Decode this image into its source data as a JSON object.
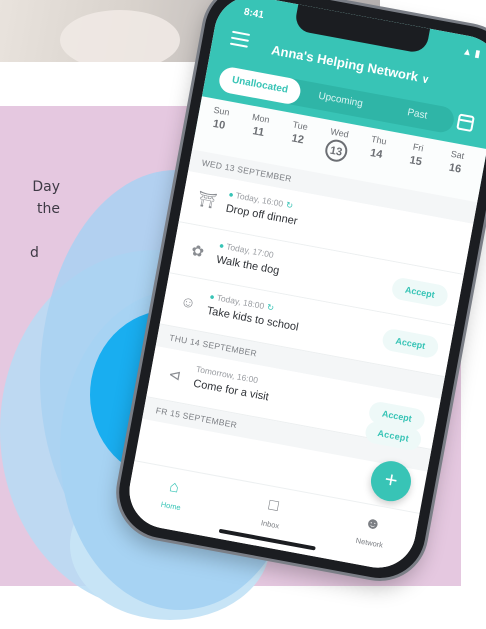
{
  "side_text": [
    "Day",
    "the",
    "d"
  ],
  "phone": {
    "status_time": "8:41",
    "status_icons": "▲ ▮",
    "network_title": "Anna's Helping Network",
    "chevron": "∨",
    "tabs": [
      {
        "label": "Unallocated",
        "active": true
      },
      {
        "label": "Upcoming",
        "active": false
      },
      {
        "label": "Past",
        "active": false
      }
    ],
    "week": [
      {
        "name": "Sun",
        "date": "10"
      },
      {
        "name": "Mon",
        "date": "11"
      },
      {
        "name": "Tue",
        "date": "12"
      },
      {
        "name": "Wed",
        "date": "13",
        "selected": true
      },
      {
        "name": "Thu",
        "date": "14"
      },
      {
        "name": "Fri",
        "date": "15"
      },
      {
        "name": "Sat",
        "date": "16"
      }
    ],
    "sections": [
      {
        "header": "WED 13 SEPTEMBER"
      },
      {
        "header": "THU 14 SEPTEMBER"
      },
      {
        "header": "FR 15 SEPTEMBER"
      }
    ],
    "tasks": [
      {
        "when": "Today, 16:00",
        "title": "Drop off dinner",
        "icon": "dish-icon",
        "repeat": true,
        "accept": ""
      },
      {
        "when": "Today, 17:00",
        "title": "Walk the dog",
        "icon": "paw-icon",
        "repeat": false,
        "accept": "Accept"
      },
      {
        "when": "Today, 18:00",
        "title": "Take kids to school",
        "icon": "baby-icon",
        "repeat": true,
        "accept": "Accept"
      },
      {
        "when": "Tomorrow, 16:00",
        "title": "Come for a visit",
        "icon": "share-icon",
        "repeat": false,
        "accept": "Accept"
      }
    ],
    "accept_label_last": "Accept",
    "fab_label": "+",
    "nav": [
      {
        "label": "Home",
        "icon": "home-icon",
        "active": true
      },
      {
        "label": "Inbox",
        "icon": "inbox-icon",
        "active": false
      },
      {
        "label": "Network",
        "icon": "people-icon",
        "active": false
      }
    ]
  },
  "colors": {
    "accent": "#38c4b6",
    "pink_panel": "#e5c8e0",
    "blue_blob": "#19aef0"
  }
}
